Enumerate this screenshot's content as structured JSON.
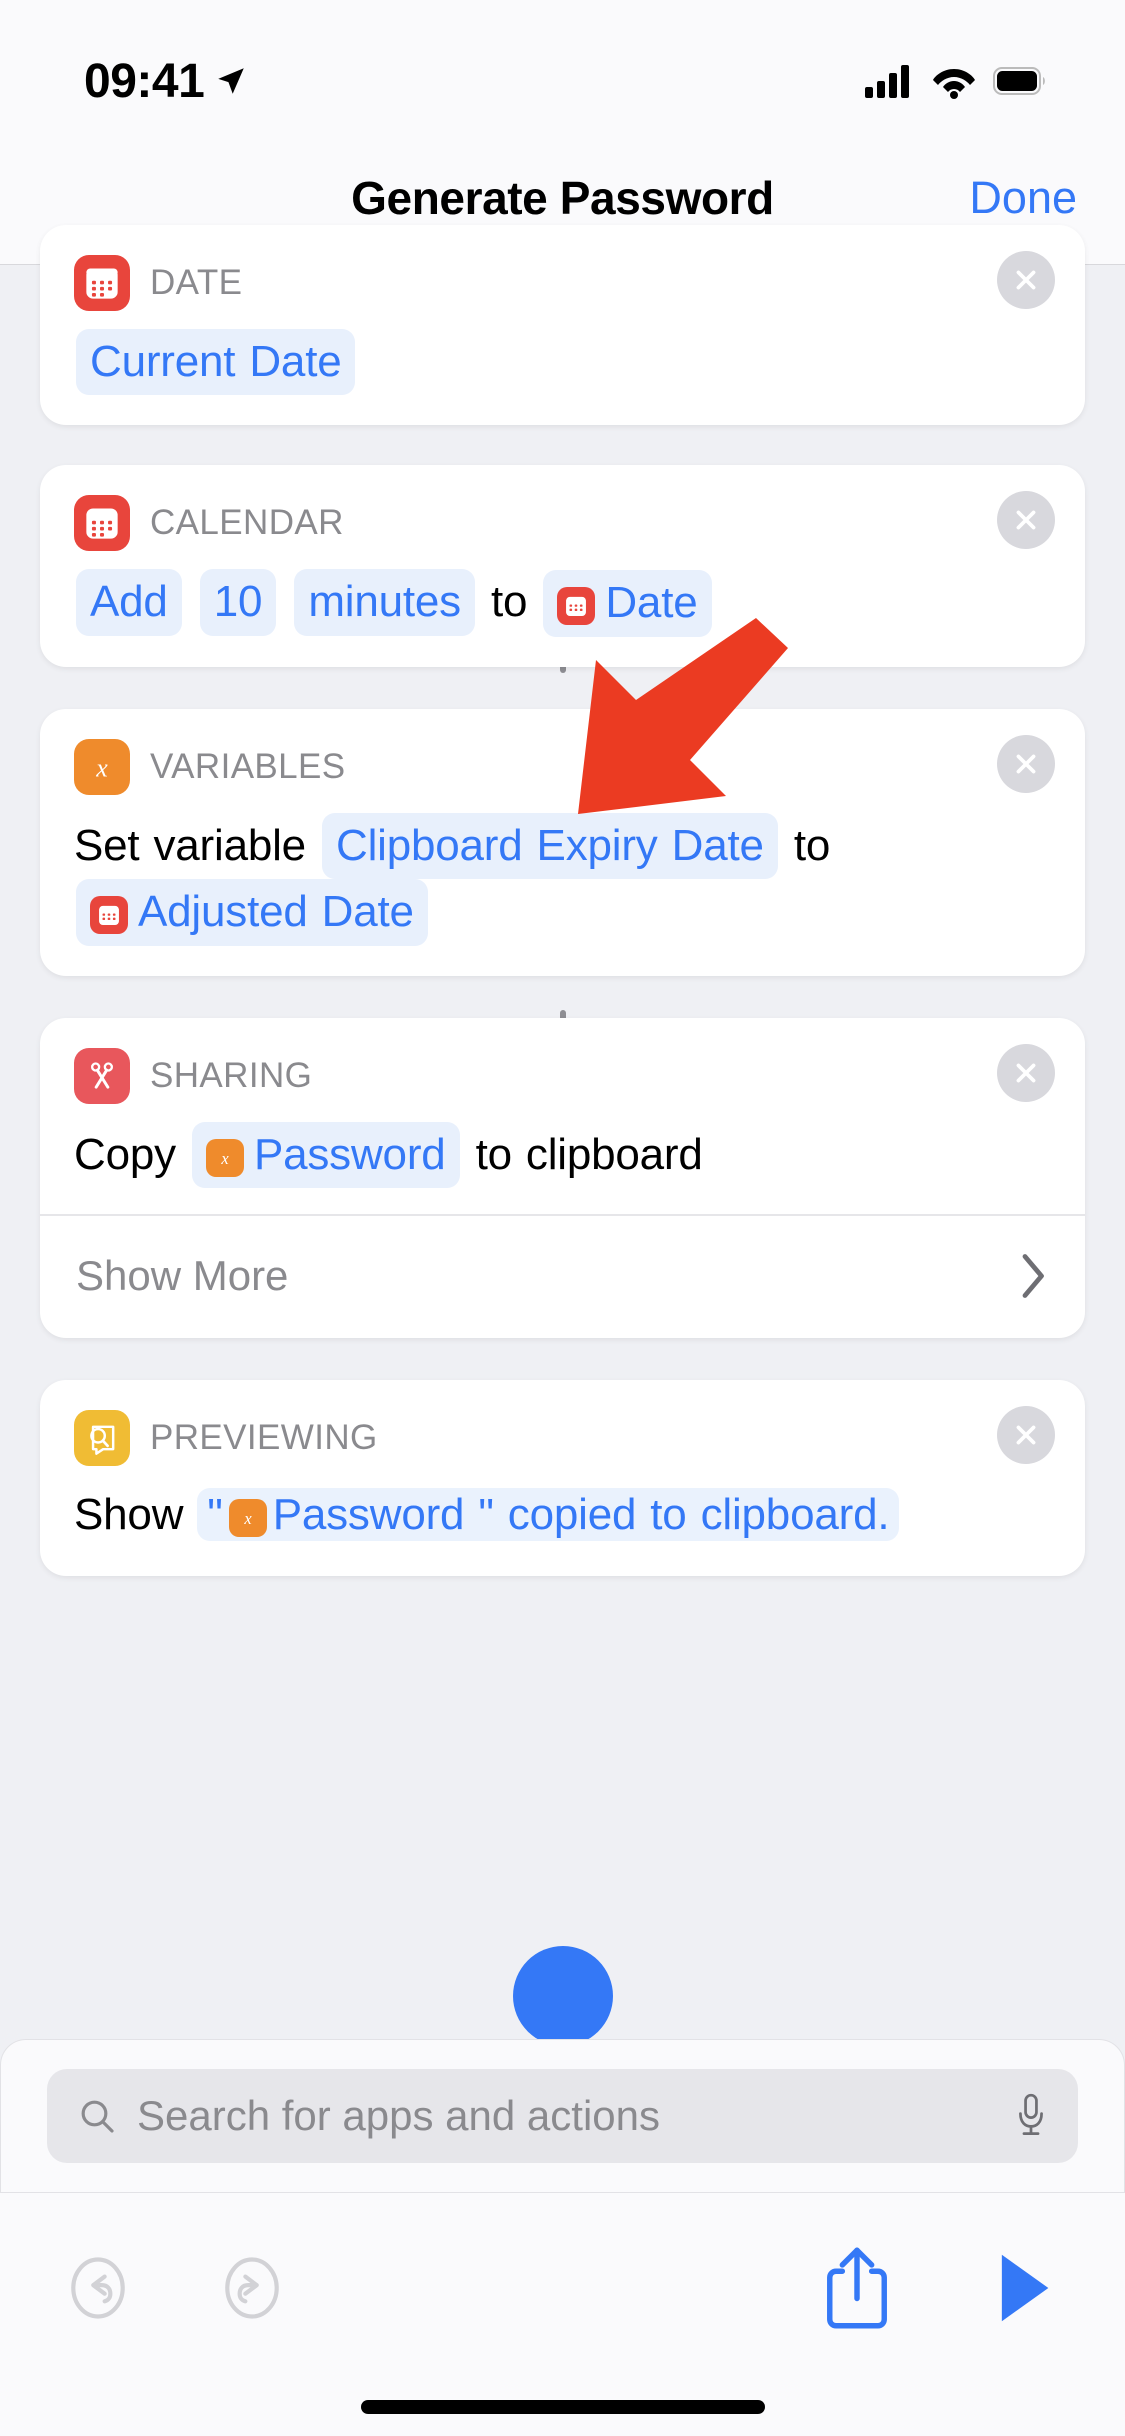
{
  "status_bar": {
    "time": "09:41",
    "icons": [
      "location-arrow-icon",
      "cellular-signal-icon",
      "wifi-icon",
      "battery-icon"
    ]
  },
  "nav_bar": {
    "title": "Generate Password",
    "done_label": "Done"
  },
  "actions": [
    {
      "app_label": "DATE",
      "icon": "calendar-icon",
      "icon_color": "#e8453c",
      "body": [
        {
          "type": "chip",
          "text": "Current Date"
        }
      ],
      "close": "remove-action-button"
    },
    {
      "app_label": "CALENDAR",
      "icon": "calendar-icon",
      "icon_color": "#e8453c",
      "body": [
        {
          "type": "chip",
          "text": "Add"
        },
        {
          "type": "chip",
          "text": "10"
        },
        {
          "type": "chip",
          "text": "minutes"
        },
        {
          "type": "text",
          "text": "to"
        },
        {
          "type": "chip",
          "text": "Date",
          "chip_icon": "calendar-icon",
          "chip_icon_color": "#e8453c"
        }
      ],
      "close": "remove-action-button"
    },
    {
      "app_label": "VARIABLES",
      "icon": "variable-x-icon",
      "icon_color": "#ef8b2c",
      "body": [
        {
          "type": "text",
          "text": "Set variable"
        },
        {
          "type": "chip",
          "text": "Clipboard Expiry Date"
        },
        {
          "type": "text",
          "text": "to"
        },
        {
          "type": "chip",
          "text": "Adjusted Date",
          "chip_icon": "calendar-icon",
          "chip_icon_color": "#e8453c"
        }
      ],
      "close": "remove-action-button"
    },
    {
      "app_label": "SHARING",
      "icon": "scissors-icon",
      "icon_color": "#e8575c",
      "body": [
        {
          "type": "text",
          "text": "Copy"
        },
        {
          "type": "chip",
          "text": "Password",
          "chip_icon": "variable-x-icon",
          "chip_icon_color": "#ef8b2c"
        },
        {
          "type": "text",
          "text": "to clipboard"
        }
      ],
      "show_more_label": "Show More",
      "show_more_icon": "chevron-right-icon",
      "close": "remove-action-button"
    },
    {
      "app_label": "PREVIEWING",
      "icon": "quick-look-icon",
      "icon_color": "#f0bc34",
      "body": [
        {
          "type": "text",
          "text": "Show"
        },
        {
          "type": "quoted",
          "pre": "\"",
          "chip_icon": "variable-x-icon",
          "chip_icon_color": "#ef8b2c",
          "text": "Password",
          "post": "\" copied to clipboard."
        }
      ],
      "close": "remove-action-button"
    }
  ],
  "search": {
    "placeholder": "Search for apps and actions",
    "search_icon": "search-icon",
    "mic_icon": "microphone-icon"
  },
  "toolbar": {
    "undo": "undo-icon",
    "redo": "redo-icon",
    "share": "share-icon",
    "play": "play-icon"
  },
  "annotation": {
    "arrow": "red-pointer-arrow",
    "color": "#eb3b22"
  },
  "colors": {
    "accent_blue": "#3478f6",
    "chip_bg": "#e8f0fc",
    "page_bg": "#eff0f4",
    "card_bg": "#ffffff",
    "label_gray": "#8a8a8e"
  }
}
